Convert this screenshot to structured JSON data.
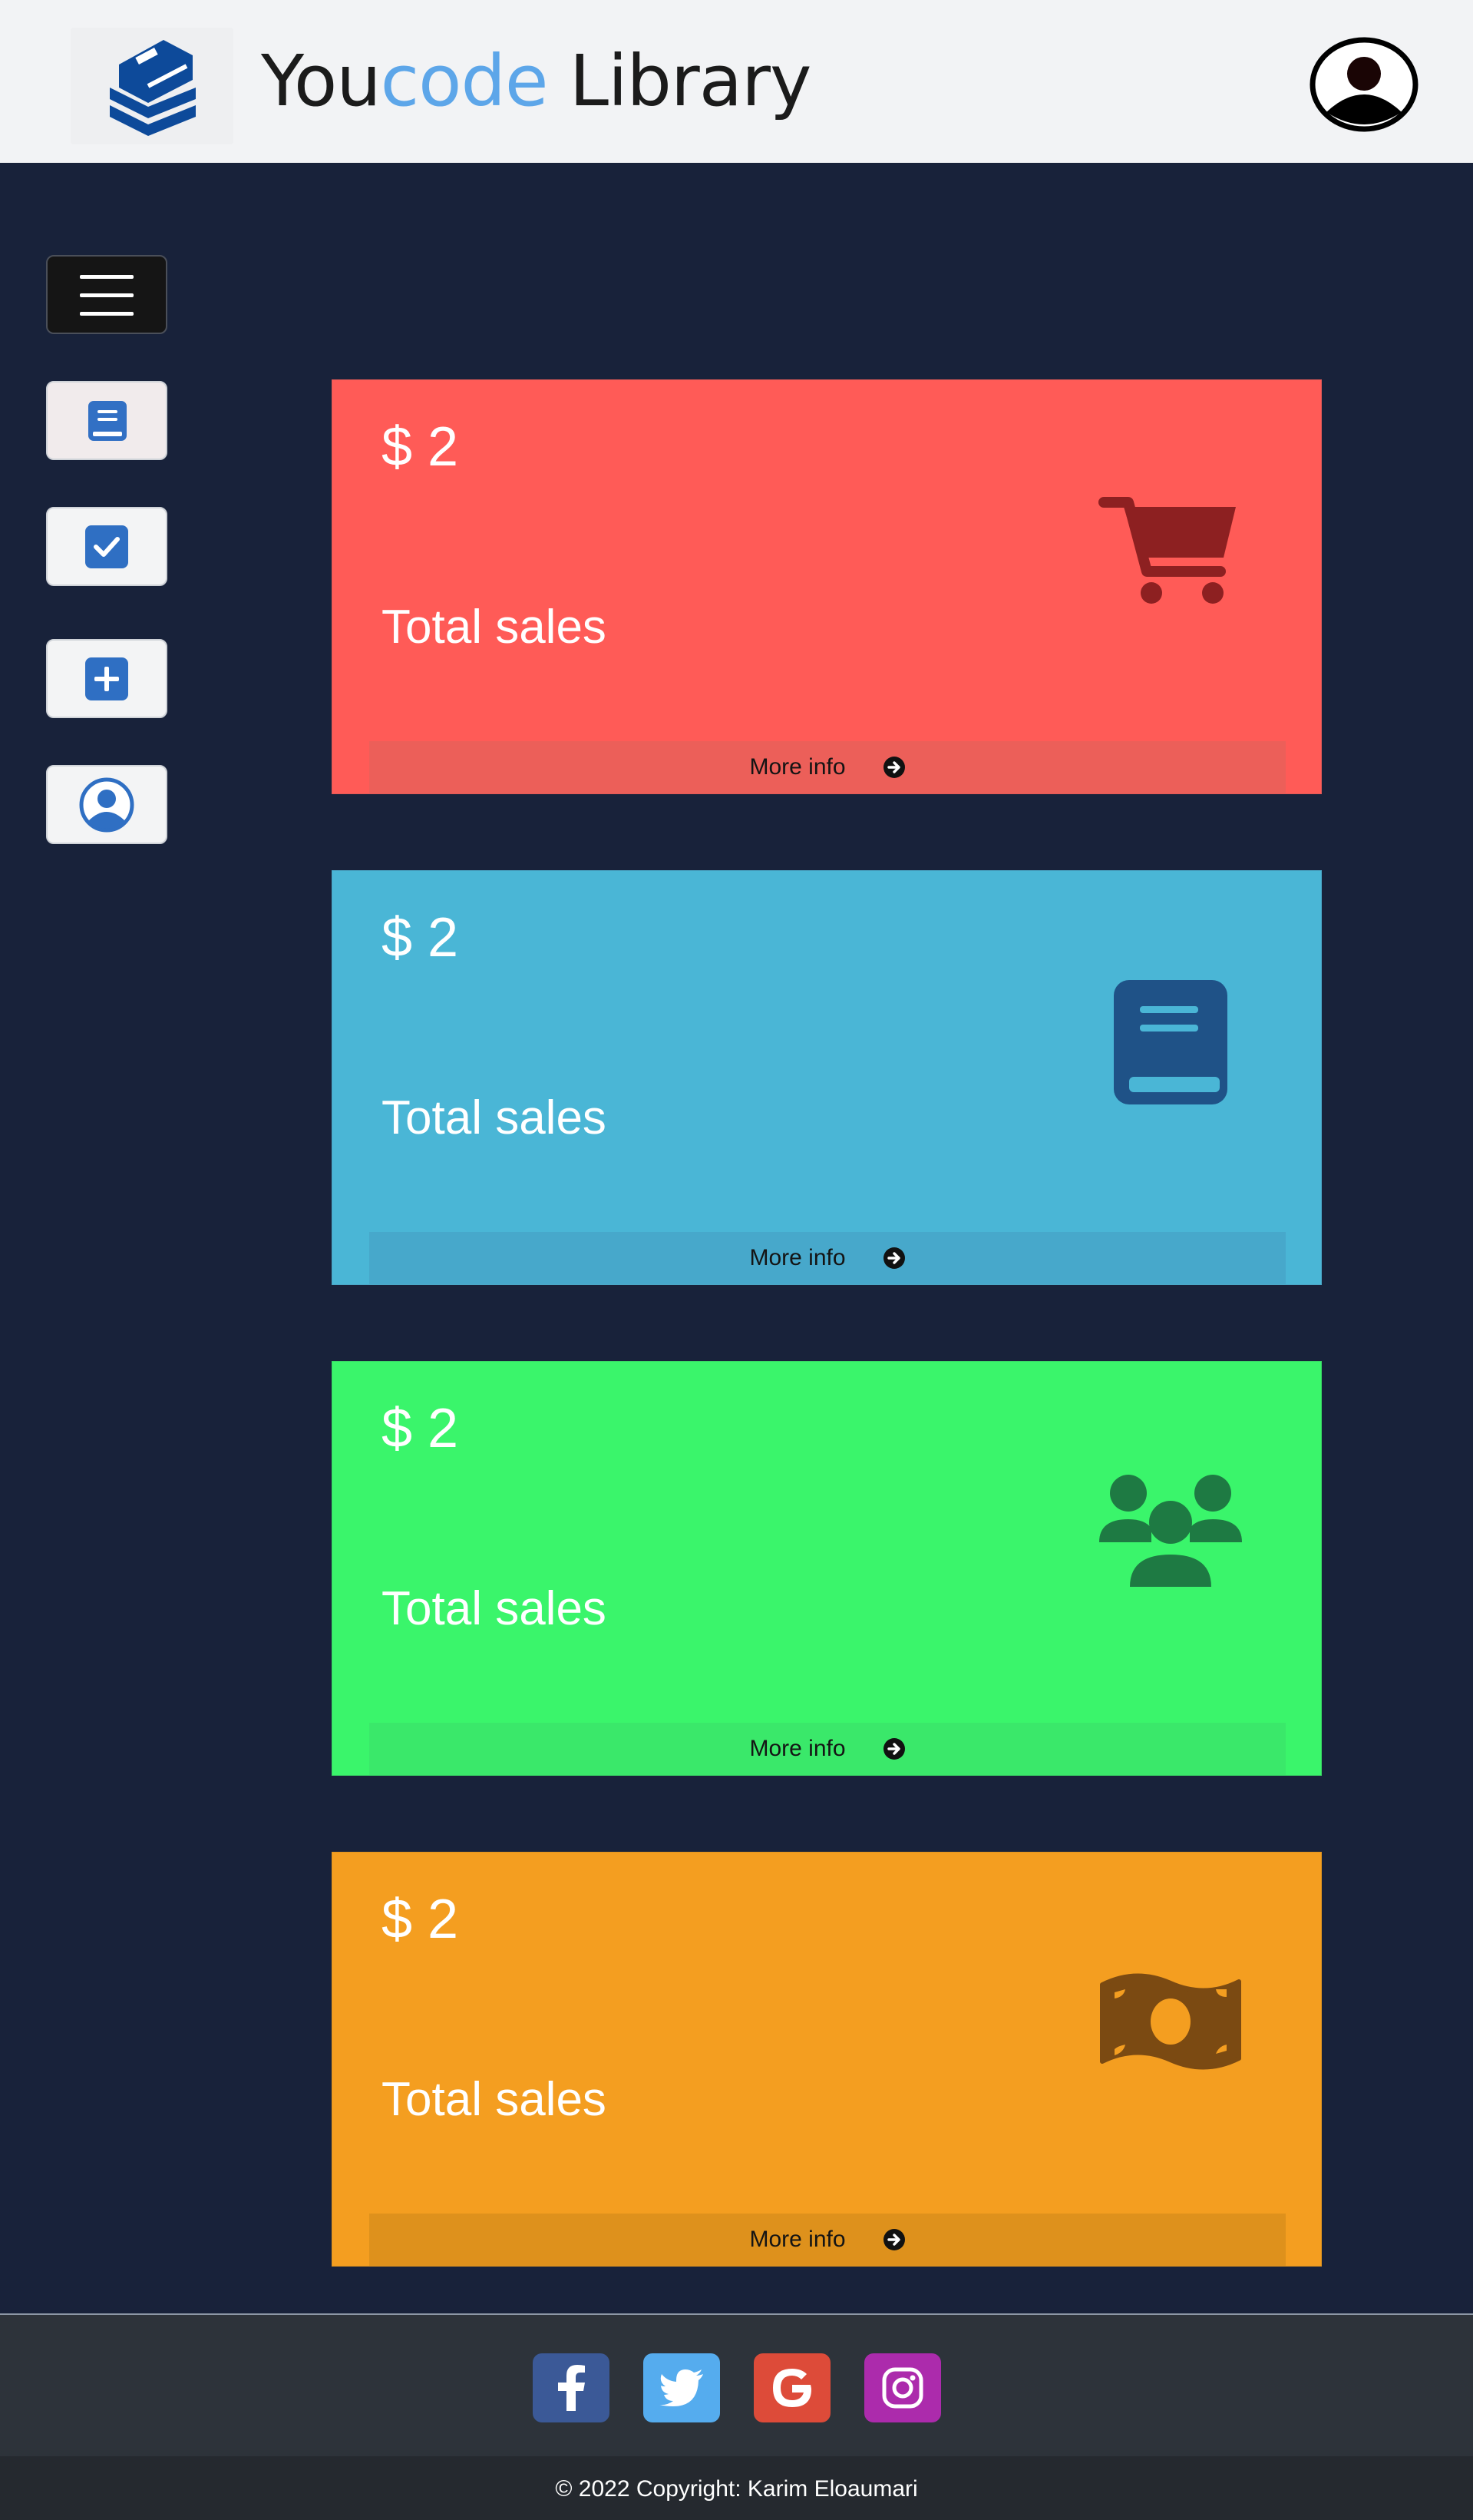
{
  "header": {
    "brand_part1": "You",
    "brand_part2": "code",
    "brand_part3": " Library",
    "logo_icon": "books-icon",
    "avatar_icon": "user-circle-icon"
  },
  "sidebar": {
    "items": [
      {
        "icon": "hamburger-menu-icon"
      },
      {
        "icon": "book-icon"
      },
      {
        "icon": "checkbox-icon"
      },
      {
        "icon": "plus-square-icon"
      },
      {
        "icon": "user-circle-icon"
      }
    ]
  },
  "cards": [
    {
      "amount": "$ 2",
      "label": "Total sales",
      "more": "More info",
      "icon": "shopping-cart-icon",
      "color": "#ff5b57"
    },
    {
      "amount": "$ 2",
      "label": "Total sales",
      "more": "More info",
      "icon": "book-icon",
      "color": "#4ab6d6"
    },
    {
      "amount": "$ 2",
      "label": "Total sales",
      "more": "More info",
      "icon": "users-icon",
      "color": "#3af56b"
    },
    {
      "amount": "$ 2",
      "label": "Total sales",
      "more": "More info",
      "icon": "money-bill-icon",
      "color": "#f49e20"
    }
  ],
  "footer": {
    "social": [
      "facebook-icon",
      "twitter-icon",
      "google-icon",
      "instagram-icon"
    ],
    "copyright": "© 2022 Copyright: Karim Eloaumari"
  },
  "colors": {
    "accent": "#5da6e9",
    "background": "#18223a"
  }
}
